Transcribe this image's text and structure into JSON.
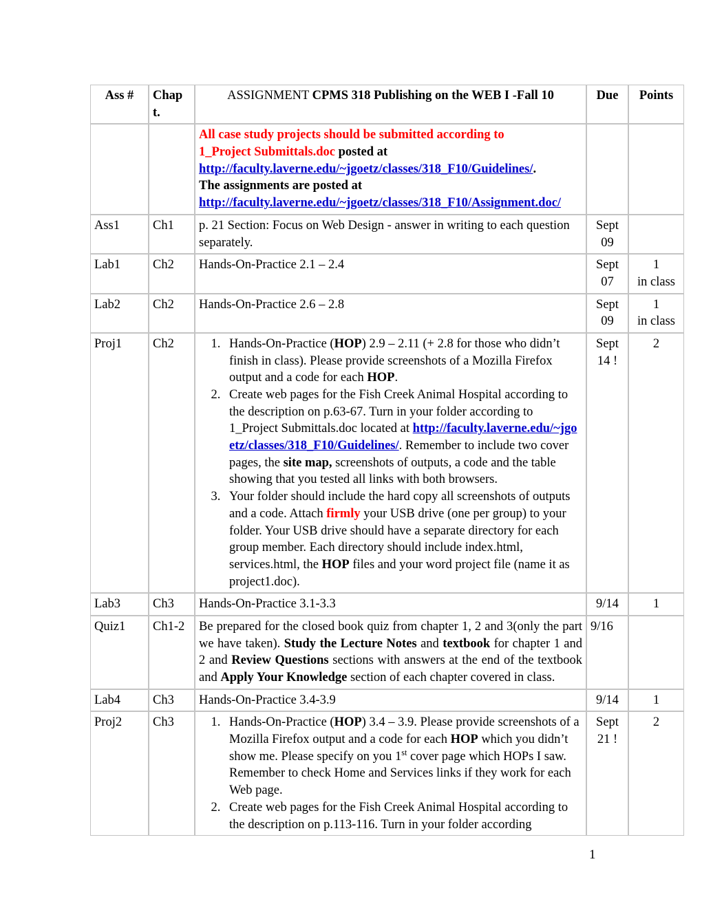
{
  "document": {
    "page_number": "1"
  },
  "table": {
    "headers": {
      "ass": "Ass #",
      "chapt": "Chap t.",
      "chapt_line1": "Chap",
      "chapt_line2": "t.",
      "assignment_prefix": "ASSIGNMENT ",
      "assignment_bold": "CPMS 318 Publishing on the WEB I -Fall 10",
      "due": "Due",
      "points": "Points"
    },
    "notice_row": {
      "red_line1": "All case study projects should be submitted according to",
      "red_line2": "1_Project Submittals.doc",
      "black_after_red": " posted at",
      "link1": "http://faculty.laverne.edu/~jgoetz/classes/318_F10/Guidelines/",
      "after_link1": ".",
      "black_line": "The assignments are posted at",
      "link2": "http://faculty.laverne.edu/~jgoetz/classes/318_F10/Assignment.doc/"
    },
    "rows": [
      {
        "ass": "Ass1",
        "chapt": "Ch1",
        "assignment": "p. 21 Section: Focus on Web Design - answer in writing to each question separately.",
        "due_line1": "Sept",
        "due_line2": "09",
        "points_line1": "",
        "points_line2": ""
      },
      {
        "ass": "Lab1",
        "chapt": "Ch2",
        "assignment": "Hands-On-Practice 2.1 – 2.4",
        "due_line1": "Sept",
        "due_line2": "07",
        "points_line1": "1",
        "points_line2": "in class"
      },
      {
        "ass": "Lab2",
        "chapt": "Ch2",
        "assignment": "Hands-On-Practice 2.6 – 2.8",
        "due_line1": "Sept",
        "due_line2": "09",
        "points_line1": "1",
        "points_line2": "in class"
      },
      {
        "ass": "Proj1",
        "chapt": "Ch2",
        "due_line1": "Sept",
        "due_line2": "14 !",
        "points_line1": "2",
        "points_line2": "",
        "items": {
          "item1_a": "Hands-On-Practice (",
          "item1_hop": "HOP",
          "item1_b": ") 2.9 – 2.11 (+ 2.8 for those who didn’t finish in class). Please provide screenshots of a Mozilla Firefox output and a code for each ",
          "item1_hop2": "HOP",
          "item1_c": ".",
          "item2_a": "Create web pages for the Fish Creek Animal Hospital according to the description on p.63-67. Turn in your folder according to 1_Project Submittals.doc located at ",
          "item2_link": "http://faculty.laverne.edu/~jgoetz/classes/318_F10/Guidelines/",
          "item2_b": ". Remember to include two cover pages, the ",
          "item2_bold": "site map,",
          "item2_c": " screenshots of outputs, a code and the table showing that you tested all links with both browsers.",
          "item3_a": "Your folder should include the hard copy all screenshots of outputs and a code. Attach ",
          "item3_red": "firmly",
          "item3_b": " your USB drive (one per group) to your folder. Your USB drive should have a separate directory for each group member. Each directory should include index.html, services.html, the ",
          "item3_bold": "HOP",
          "item3_c": " files and your word project file (name it as project1.doc)."
        }
      },
      {
        "ass": "Lab3",
        "chapt": "Ch3",
        "assignment": "Hands-On-Practice 3.1-3.3",
        "due_line1": "9/14",
        "due_line2": "",
        "points_line1": "1",
        "points_line2": ""
      },
      {
        "ass": "Quiz1",
        "chapt": "Ch1-2",
        "due_line1": "9/16",
        "due_line2": "",
        "points_line1": "",
        "points_line2": "",
        "quiz": {
          "a": "Be prepared for the closed book quiz from chapter 1, 2 and 3(only the part we have taken). ",
          "b_bold": "Study the Lecture Notes",
          "c": " and ",
          "d_bold": "textbook",
          "e": " for chapter 1 and  2 and ",
          "f_bold": "Review Questions",
          "g": " sections with answers at the end of the textbook and ",
          "h_bold": "Apply Your Knowledge",
          "i": " section of each chapter covered in class."
        }
      },
      {
        "ass": "Lab4",
        "chapt": "Ch3",
        "assignment": "Hands-On-Practice 3.4-3.9",
        "due_line1": "9/14",
        "due_line2": "",
        "points_line1": "1",
        "points_line2": ""
      },
      {
        "ass": "Proj2",
        "chapt": "Ch3",
        "due_line1": "Sept",
        "due_line2": "21 !",
        "points_line1": "2",
        "points_line2": "",
        "items": {
          "item1_a": "Hands-On-Practice (",
          "item1_hop": "HOP",
          "item1_b": ") 3.4 – 3.9. Please provide screenshots of a Mozilla Firefox output and a code for each ",
          "item1_hop2": "HOP",
          "item1_c": " which you didn’t show me. Please specify on you 1",
          "item1_sup": "st",
          "item1_d": " cover page which HOPs I saw. Remember to check Home and Services links if they work for each Web page.",
          "item2_a": "Create web pages for the Fish Creek Animal Hospital according to the description on p.113-116. Turn in your folder according"
        }
      }
    ]
  },
  "colors": {
    "link": "#0000cc",
    "alert": "#ff0000",
    "border": "#c4c4c4",
    "text": "#000000"
  }
}
